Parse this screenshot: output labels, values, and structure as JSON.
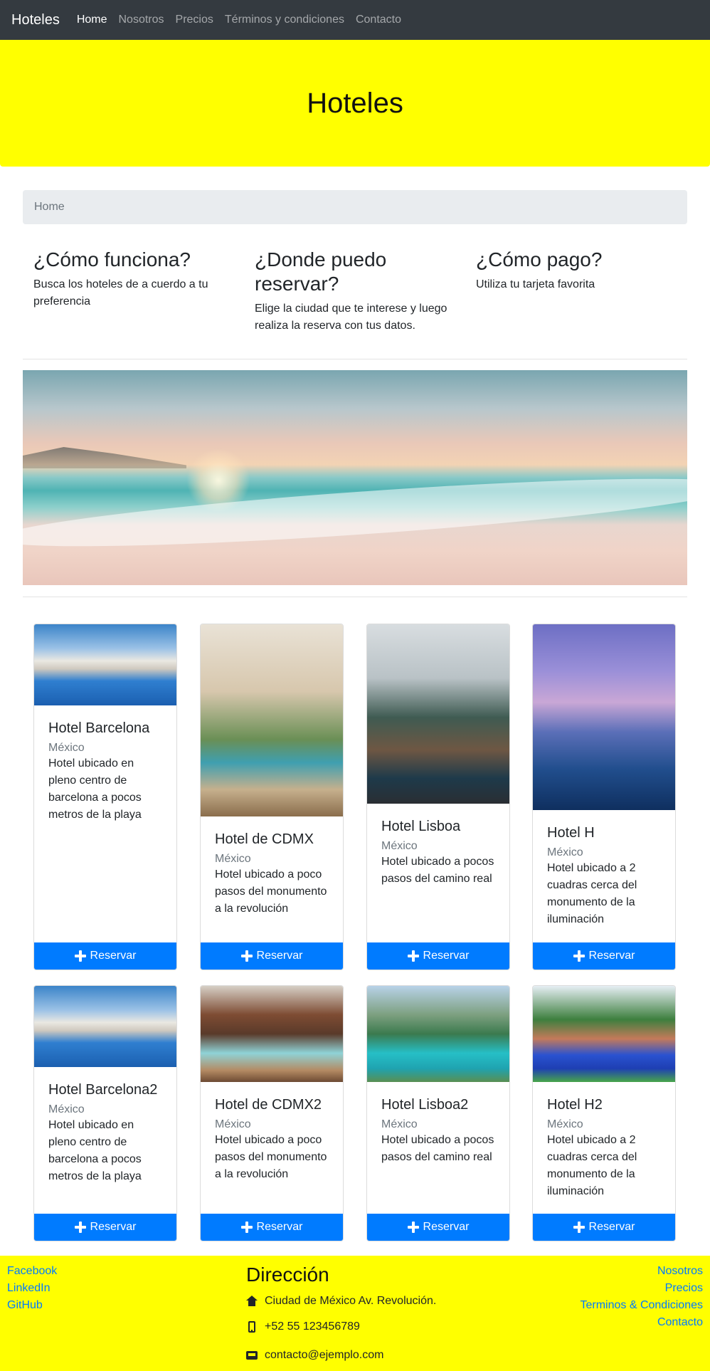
{
  "navbar": {
    "brand": "Hoteles",
    "links": [
      {
        "label": "Home",
        "active": true
      },
      {
        "label": "Nosotros",
        "active": false
      },
      {
        "label": "Precios",
        "active": false
      },
      {
        "label": "Términos y condiciones",
        "active": false
      },
      {
        "label": "Contacto",
        "active": false
      }
    ]
  },
  "hero": {
    "title": "Hoteles",
    "background": "#ffff00"
  },
  "breadcrumb": {
    "current": "Home"
  },
  "info": [
    {
      "title": "¿Cómo funciona?",
      "text": "Busca los hoteles de a cuerdo a tu preferencia"
    },
    {
      "title": "¿Donde puedo reservar?",
      "text": "Elige la ciudad que te interese y luego realiza la reserva con tus datos."
    },
    {
      "title": "¿Cómo pago?",
      "text": "Utiliza tu tarjeta favorita"
    }
  ],
  "hotels": [
    {
      "name": "Hotel Barcelona",
      "country": "México",
      "description": "Hotel ubicado en pleno centro de barcelona a pocos metros de la playa",
      "button": "Reservar",
      "image": "pool-villa"
    },
    {
      "name": "Hotel de CDMX",
      "country": "México",
      "description": "Hotel ubicado a poco pasos del monumento a la revolución",
      "button": "Reservar",
      "image": "courtyard-pool"
    },
    {
      "name": "Hotel Lisboa",
      "country": "México",
      "description": "Hotel ubicado a pocos pasos del camino real",
      "button": "Reservar",
      "image": "palm-pool"
    },
    {
      "name": "Hotel H",
      "country": "México",
      "description": "Hotel ubicado a 2 cuadras cerca del monumento de la iluminación",
      "button": "Reservar",
      "image": "sunset-pool"
    },
    {
      "name": "Hotel Barcelona2",
      "country": "México",
      "description": "Hotel ubicado en pleno centro de barcelona a pocos metros de la playa",
      "button": "Reservar",
      "image": "pool-villa"
    },
    {
      "name": "Hotel de CDMX2",
      "country": "México",
      "description": "Hotel ubicado a poco pasos del monumento a la revolución",
      "button": "Reservar",
      "image": "hut-pool"
    },
    {
      "name": "Hotel Lisboa2",
      "country": "México",
      "description": "Hotel ubicado a pocos pasos del camino real",
      "button": "Reservar",
      "image": "resort-pool"
    },
    {
      "name": "Hotel H2",
      "country": "México",
      "description": "Hotel ubicado a 2 cuadras cerca del monumento de la iluminación",
      "button": "Reservar",
      "image": "blue-pool"
    }
  ],
  "footer": {
    "social": [
      "Facebook",
      "LinkedIn",
      "GitHub"
    ],
    "address_title": "Dirección",
    "address": "Ciudad de México Av. Revolución.",
    "phone": "+52 55 123456789",
    "email": "contacto@ejemplo.com",
    "links": [
      "Nosotros",
      "Precios",
      "Terminos & Condiciones",
      "Contacto"
    ],
    "background": "#ffff00"
  },
  "colors": {
    "primary": "#007bff",
    "navbar": "#343a40",
    "hero": "#ffff00"
  }
}
